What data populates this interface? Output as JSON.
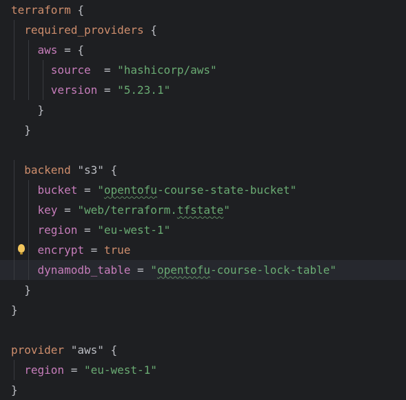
{
  "editor": {
    "lines": [
      [
        {
          "t": "terraform",
          "c": "kw"
        },
        {
          "t": " {",
          "c": "pun"
        }
      ],
      [
        {
          "t": "  "
        },
        {
          "t": "required_providers",
          "c": "kw"
        },
        {
          "t": " {",
          "c": "pun"
        }
      ],
      [
        {
          "t": "    "
        },
        {
          "t": "aws",
          "c": "prop"
        },
        {
          "t": " = {",
          "c": "pun"
        }
      ],
      [
        {
          "t": "      "
        },
        {
          "t": "source",
          "c": "prop"
        },
        {
          "t": "  = ",
          "c": "pun"
        },
        {
          "t": "\"hashicorp/aws\"",
          "c": "str"
        }
      ],
      [
        {
          "t": "      "
        },
        {
          "t": "version",
          "c": "prop"
        },
        {
          "t": " = ",
          "c": "pun"
        },
        {
          "t": "\"5.23.1\"",
          "c": "str"
        }
      ],
      [
        {
          "t": "    }",
          "c": "pun"
        }
      ],
      [
        {
          "t": "  }",
          "c": "pun"
        }
      ],
      [],
      [
        {
          "t": "  "
        },
        {
          "t": "backend",
          "c": "kw"
        },
        {
          "t": " \"s3\" {",
          "c": "pun"
        }
      ],
      [
        {
          "t": "    "
        },
        {
          "t": "bucket",
          "c": "prop"
        },
        {
          "t": " = ",
          "c": "pun"
        },
        {
          "t": "\"",
          "c": "str"
        },
        {
          "t": "opentofu",
          "c": "str wavy"
        },
        {
          "t": "-course-state-bucket\"",
          "c": "str"
        }
      ],
      [
        {
          "t": "    "
        },
        {
          "t": "key",
          "c": "prop"
        },
        {
          "t": " = ",
          "c": "pun"
        },
        {
          "t": "\"web/terraform.",
          "c": "str"
        },
        {
          "t": "tfstate",
          "c": "str wavy"
        },
        {
          "t": "\"",
          "c": "str"
        }
      ],
      [
        {
          "t": "    "
        },
        {
          "t": "region",
          "c": "prop"
        },
        {
          "t": " = ",
          "c": "pun"
        },
        {
          "t": "\"eu-west-1\"",
          "c": "str"
        }
      ],
      [
        {
          "t": "    "
        },
        {
          "t": "encrypt",
          "c": "prop"
        },
        {
          "t": " = ",
          "c": "pun"
        },
        {
          "t": "true",
          "c": "kw"
        }
      ],
      [
        {
          "t": "    "
        },
        {
          "t": "dynamodb_table",
          "c": "prop"
        },
        {
          "t": " = ",
          "c": "pun"
        },
        {
          "t": "\"",
          "c": "str"
        },
        {
          "t": "opentofu",
          "c": "str wavy"
        },
        {
          "t": "-course-lock-table\"",
          "c": "str"
        }
      ],
      [
        {
          "t": "  }",
          "c": "pun"
        }
      ],
      [
        {
          "t": "}",
          "c": "pun"
        }
      ],
      [],
      [
        {
          "t": "provider",
          "c": "kw"
        },
        {
          "t": " \"aws\" {",
          "c": "pun"
        }
      ],
      [
        {
          "t": "  "
        },
        {
          "t": "region",
          "c": "prop"
        },
        {
          "t": " = ",
          "c": "pun"
        },
        {
          "t": "\"eu-west-1\"",
          "c": "str"
        }
      ],
      [
        {
          "t": "}",
          "c": "pun"
        }
      ]
    ],
    "current_line": 13,
    "intention_line": 12,
    "intention_icon": "lightbulb-icon"
  }
}
